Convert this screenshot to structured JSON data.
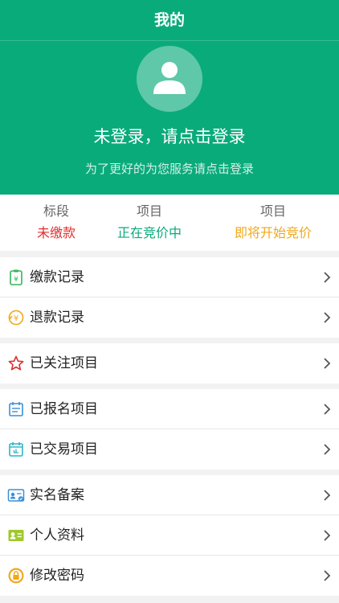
{
  "nav": {
    "title": "我的"
  },
  "profile": {
    "login_title": "未登录，请点击登录",
    "login_subtitle": "为了更好的为您服务请点击登录"
  },
  "stats": [
    {
      "label": "标段",
      "value": "未缴款",
      "color": "#e0302f"
    },
    {
      "label": "项目",
      "value": "正在竞价中",
      "color": "#0aab7a"
    },
    {
      "label": "项目",
      "value": "即将开始竞价",
      "color": "#f0a81c"
    }
  ],
  "menu": {
    "payment": {
      "label": "缴款记录",
      "icon": "payment-record-icon"
    },
    "refund": {
      "label": "退款记录",
      "icon": "refund-record-icon"
    },
    "followed": {
      "label": "已关注项目",
      "icon": "star-icon"
    },
    "registered": {
      "label": "已报名项目",
      "icon": "registration-icon"
    },
    "traded": {
      "label": "已交易项目",
      "icon": "calendar-icon"
    },
    "realname": {
      "label": "实名备案",
      "icon": "id-card-icon"
    },
    "profile": {
      "label": "个人资料",
      "icon": "profile-card-icon"
    },
    "password": {
      "label": "修改密码",
      "icon": "lock-icon"
    }
  },
  "colors": {
    "brand": "#0aab7a",
    "background": "#f2f2f2"
  }
}
